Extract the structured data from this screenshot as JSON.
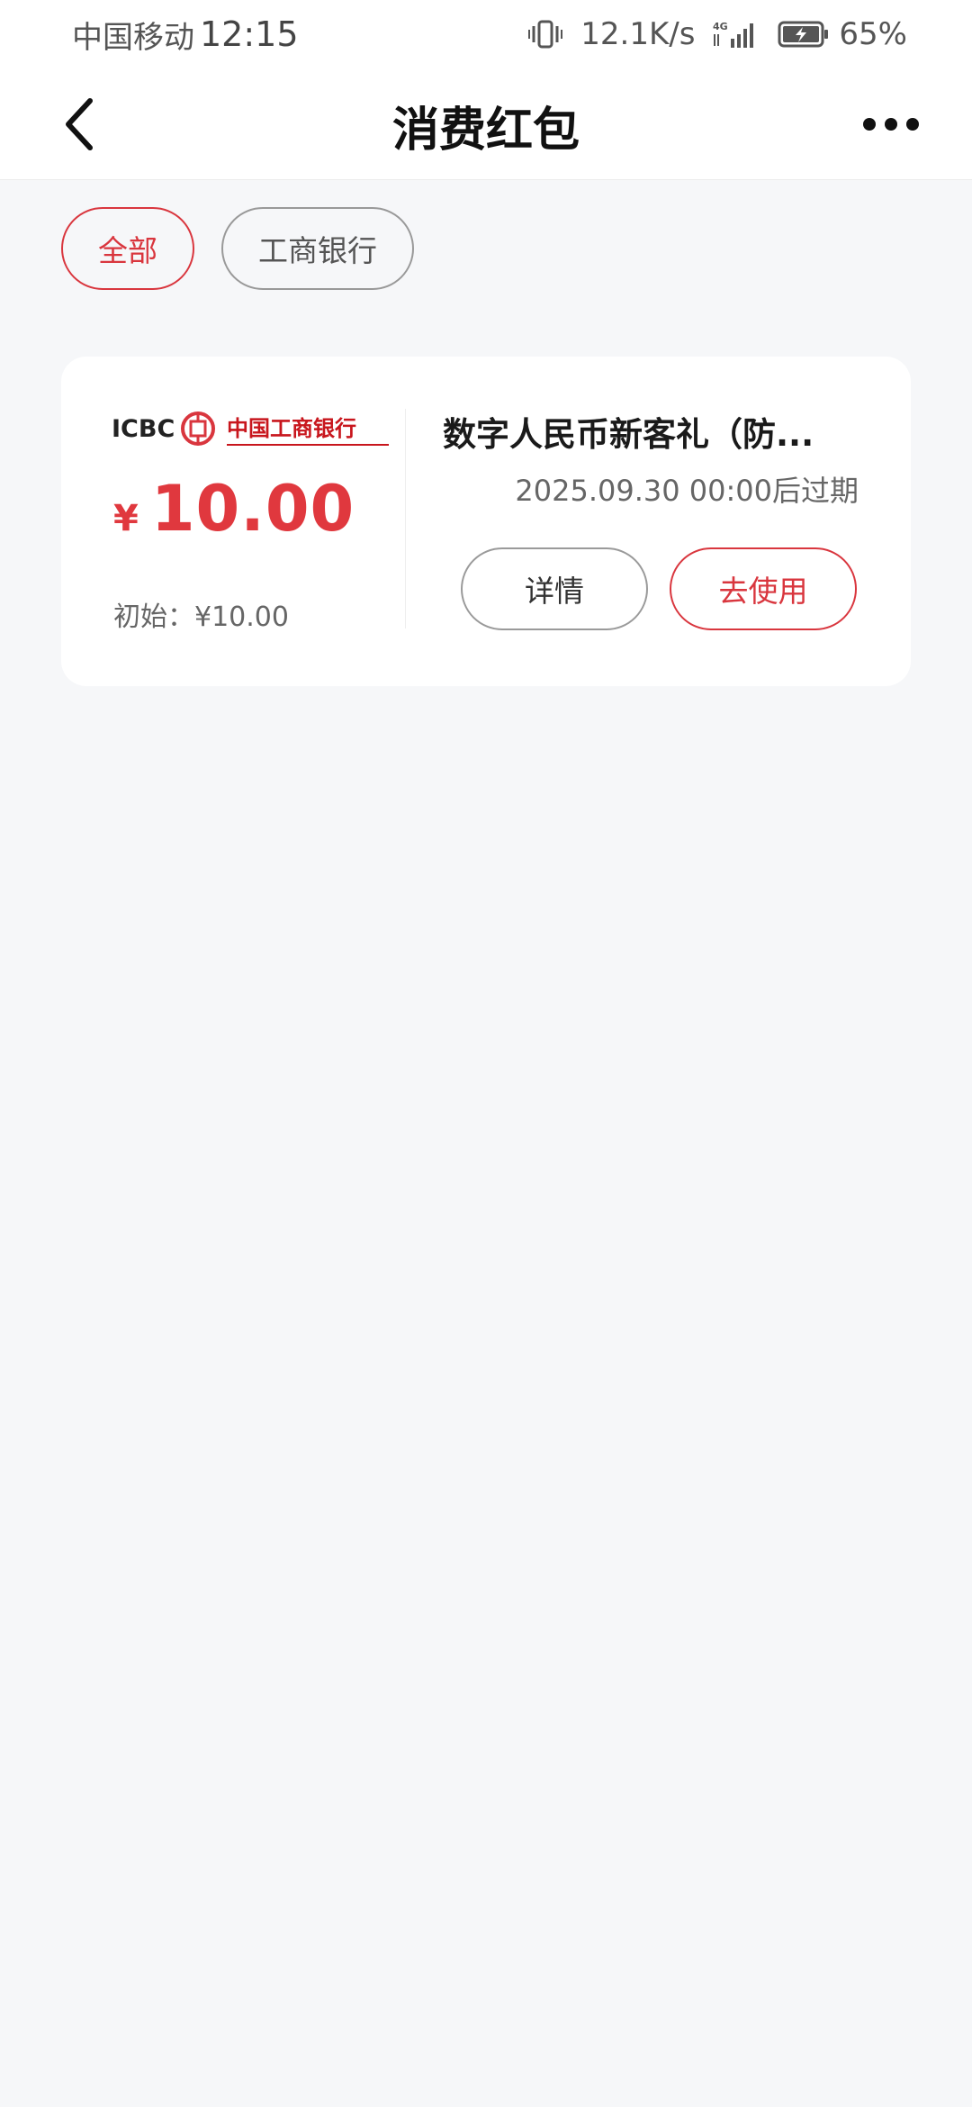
{
  "status_bar": {
    "carrier": "中国移动",
    "time": "12:15",
    "network_speed": "12.1K/s",
    "network_type": "4G",
    "battery": "65%"
  },
  "header": {
    "title": "消费红包"
  },
  "filters": [
    {
      "label": "全部",
      "selected": true
    },
    {
      "label": "工商银行",
      "selected": false
    }
  ],
  "coupon": {
    "bank_logo": {
      "en": "ICBC",
      "cn": "中国工商银行"
    },
    "currency_symbol": "¥",
    "amount": "10.00",
    "initial": "初始：¥10.00",
    "title": "数字人民币新客礼（防...",
    "expire": "2025.09.30 00:00后过期",
    "detail_label": "详情",
    "use_label": "去使用"
  },
  "colors": {
    "accent": "#d9363e",
    "amount_red": "#e0383e",
    "background": "#f6f7f9"
  }
}
